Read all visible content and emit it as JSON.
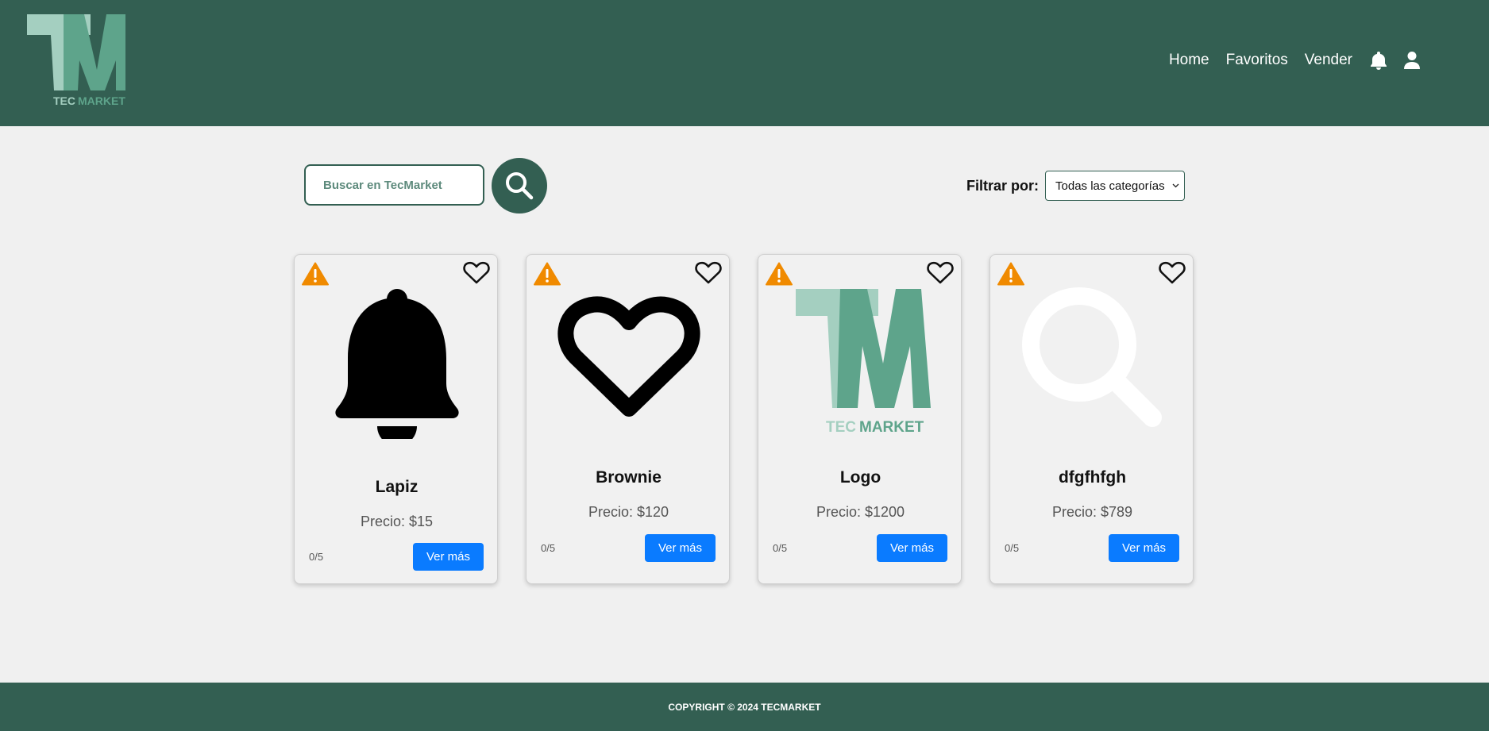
{
  "header": {
    "logo_alt": "TECMARKET",
    "nav": [
      {
        "label": "Home"
      },
      {
        "label": "Favoritos"
      },
      {
        "label": "Vender"
      }
    ]
  },
  "search": {
    "placeholder": "Buscar en TecMarket"
  },
  "filter": {
    "label": "Filtrar por:",
    "selected": "Todas las categorías"
  },
  "products": [
    {
      "title": "Lapiz",
      "price": "Precio: $15",
      "rating": "0/5",
      "button": "Ver más",
      "image_icon": "bell-icon"
    },
    {
      "title": "Brownie",
      "price": "Precio: $120",
      "rating": "0/5",
      "button": "Ver más",
      "image_icon": "heart-outline-icon"
    },
    {
      "title": "Logo",
      "price": "Precio: $1200",
      "rating": "0/5",
      "button": "Ver más",
      "image_icon": "tm-logo"
    },
    {
      "title": "dfgfhfgh",
      "price": "Precio: $789",
      "rating": "0/5",
      "button": "Ver más",
      "image_icon": "search-icon-white"
    }
  ],
  "footer": {
    "text": "COPYRIGHT © 2024 TECMARKET"
  },
  "colors": {
    "brand": "#335f52",
    "button": "#0a7bff",
    "warning": "#f08a00"
  }
}
